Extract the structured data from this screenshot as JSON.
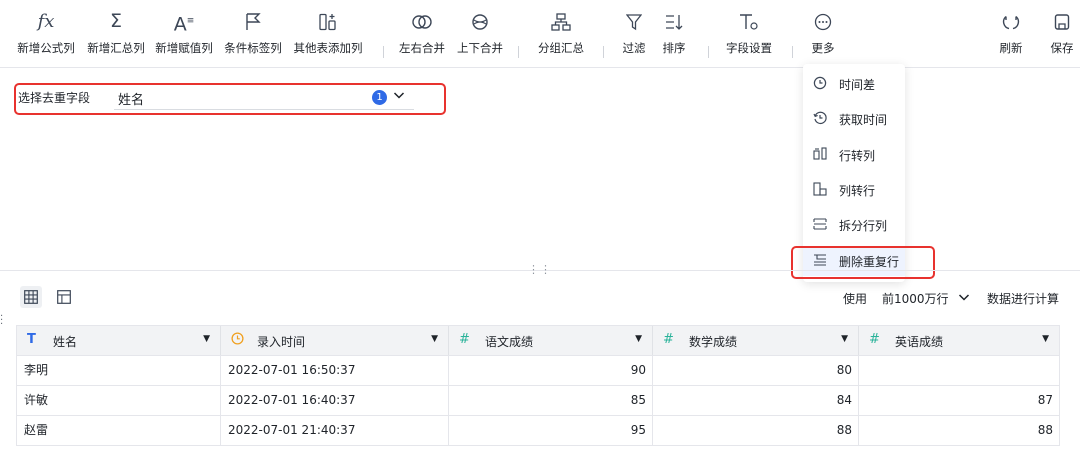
{
  "toolbar": {
    "formula_col": "新增公式列",
    "summary_col": "新增汇总列",
    "assign_col": "新增赋值列",
    "condition_col": "条件标签列",
    "other_table_col": "其他表添加列",
    "lr_merge": "左右合并",
    "ud_merge": "上下合并",
    "group_sum": "分组汇总",
    "filter": "过滤",
    "sort": "排序",
    "field_settings": "字段设置",
    "more": "更多",
    "refresh": "刷新",
    "save": "保存",
    "formula_glyph": "fx",
    "sigma_glyph": "Σ",
    "assign_glyph": "A"
  },
  "dedupe": {
    "label": "选择去重字段",
    "value": "姓名",
    "count": "1"
  },
  "menu": {
    "items": [
      {
        "label": "时间差",
        "icon": "clock-diff-icon"
      },
      {
        "label": "获取时间",
        "icon": "clock-get-icon"
      },
      {
        "label": "行转列",
        "icon": "row-to-col-icon"
      },
      {
        "label": "列转行",
        "icon": "col-to-row-icon"
      },
      {
        "label": "拆分行列",
        "icon": "split-icon"
      },
      {
        "label": "删除重复行",
        "icon": "remove-duplicate-icon"
      }
    ]
  },
  "preview": {
    "use_label": "使用",
    "row_limit": "前1000万行",
    "compute_label": "数据进行计算"
  },
  "table": {
    "columns": [
      {
        "name": "姓名",
        "type": "text"
      },
      {
        "name": "录入时间",
        "type": "datetime"
      },
      {
        "name": "语文成绩",
        "type": "number"
      },
      {
        "name": "数学成绩",
        "type": "number"
      },
      {
        "name": "英语成绩",
        "type": "number"
      }
    ],
    "rows": [
      [
        "李明",
        "2022-07-01 16:50:37",
        "90",
        "80",
        ""
      ],
      [
        "许敏",
        "2022-07-01 16:40:37",
        "85",
        "84",
        "87"
      ],
      [
        "赵雷",
        "2022-07-01 21:40:37",
        "95",
        "88",
        "88"
      ]
    ]
  },
  "colors": {
    "accent": "#2f6ae6",
    "highlight": "#e8322e",
    "datetime_icon": "#f0a020",
    "number_icon": "#2bb39a",
    "text_icon": "#2f6ae6"
  }
}
